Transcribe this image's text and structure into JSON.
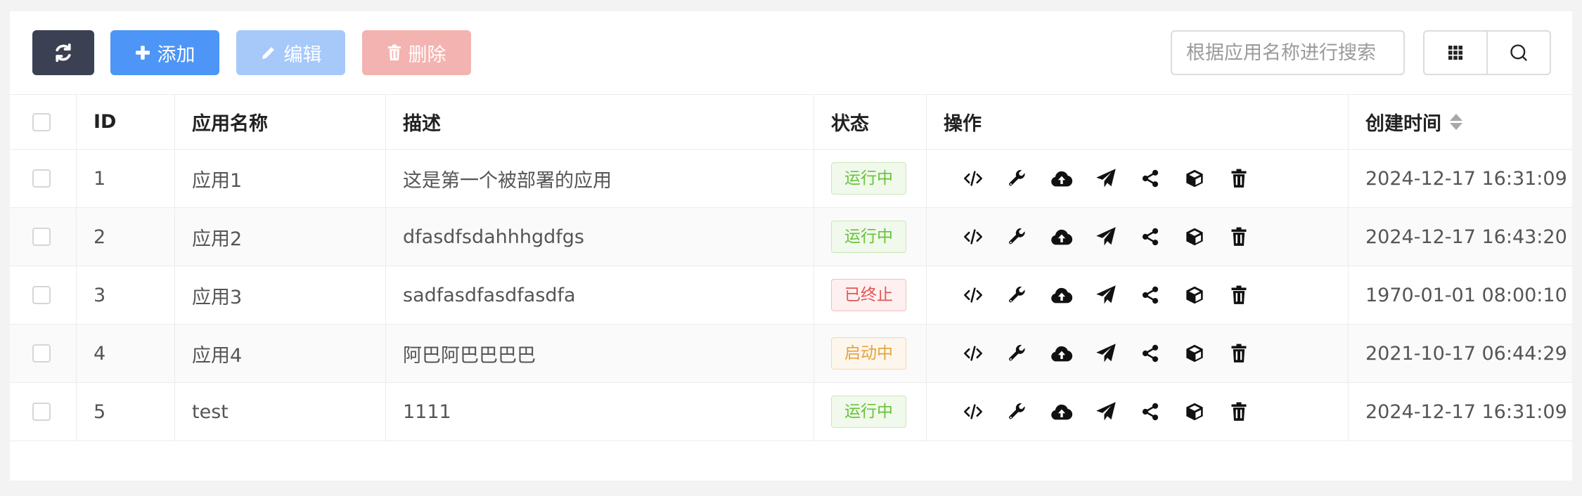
{
  "toolbar": {
    "add_label": "添加",
    "edit_label": "编辑",
    "delete_label": "删除",
    "search_placeholder": "根据应用名称进行搜索"
  },
  "table": {
    "headers": {
      "id": "ID",
      "name": "应用名称",
      "description": "描述",
      "status": "状态",
      "actions": "操作",
      "created_at": "创建时间"
    },
    "rows": [
      {
        "id": "1",
        "name": "应用1",
        "description": "这是第一个被部署的应用",
        "status": "运行中",
        "status_kind": "running",
        "created_at": "2024-12-17 16:31:09"
      },
      {
        "id": "2",
        "name": "应用2",
        "description": "dfasdfsdahhhgdfgs",
        "status": "运行中",
        "status_kind": "running",
        "created_at": "2024-12-17 16:43:20"
      },
      {
        "id": "3",
        "name": "应用3",
        "description": "sadfasdfasdfasdfa",
        "status": "已终止",
        "status_kind": "stopped",
        "created_at": "1970-01-01 08:00:10"
      },
      {
        "id": "4",
        "name": "应用4",
        "description": "阿巴阿巴巴巴巴",
        "status": "启动中",
        "status_kind": "starting",
        "created_at": "2021-10-17 06:44:29"
      },
      {
        "id": "5",
        "name": "test",
        "description": "1111",
        "status": "运行中",
        "status_kind": "running",
        "created_at": "2024-12-17 16:31:09"
      }
    ],
    "row_actions": [
      "code-icon",
      "wrench-icon",
      "cloud-upload-icon",
      "paper-plane-icon",
      "share-icon",
      "cube-icon",
      "trash-icon"
    ]
  },
  "colors": {
    "refresh_button": "#3b4152",
    "add_button": "#4d95f6",
    "edit_button": "#a6c9fa",
    "delete_button": "#f3b3b0",
    "running": "#67c23a",
    "stopped": "#e25555",
    "starting": "#e6a23c"
  }
}
